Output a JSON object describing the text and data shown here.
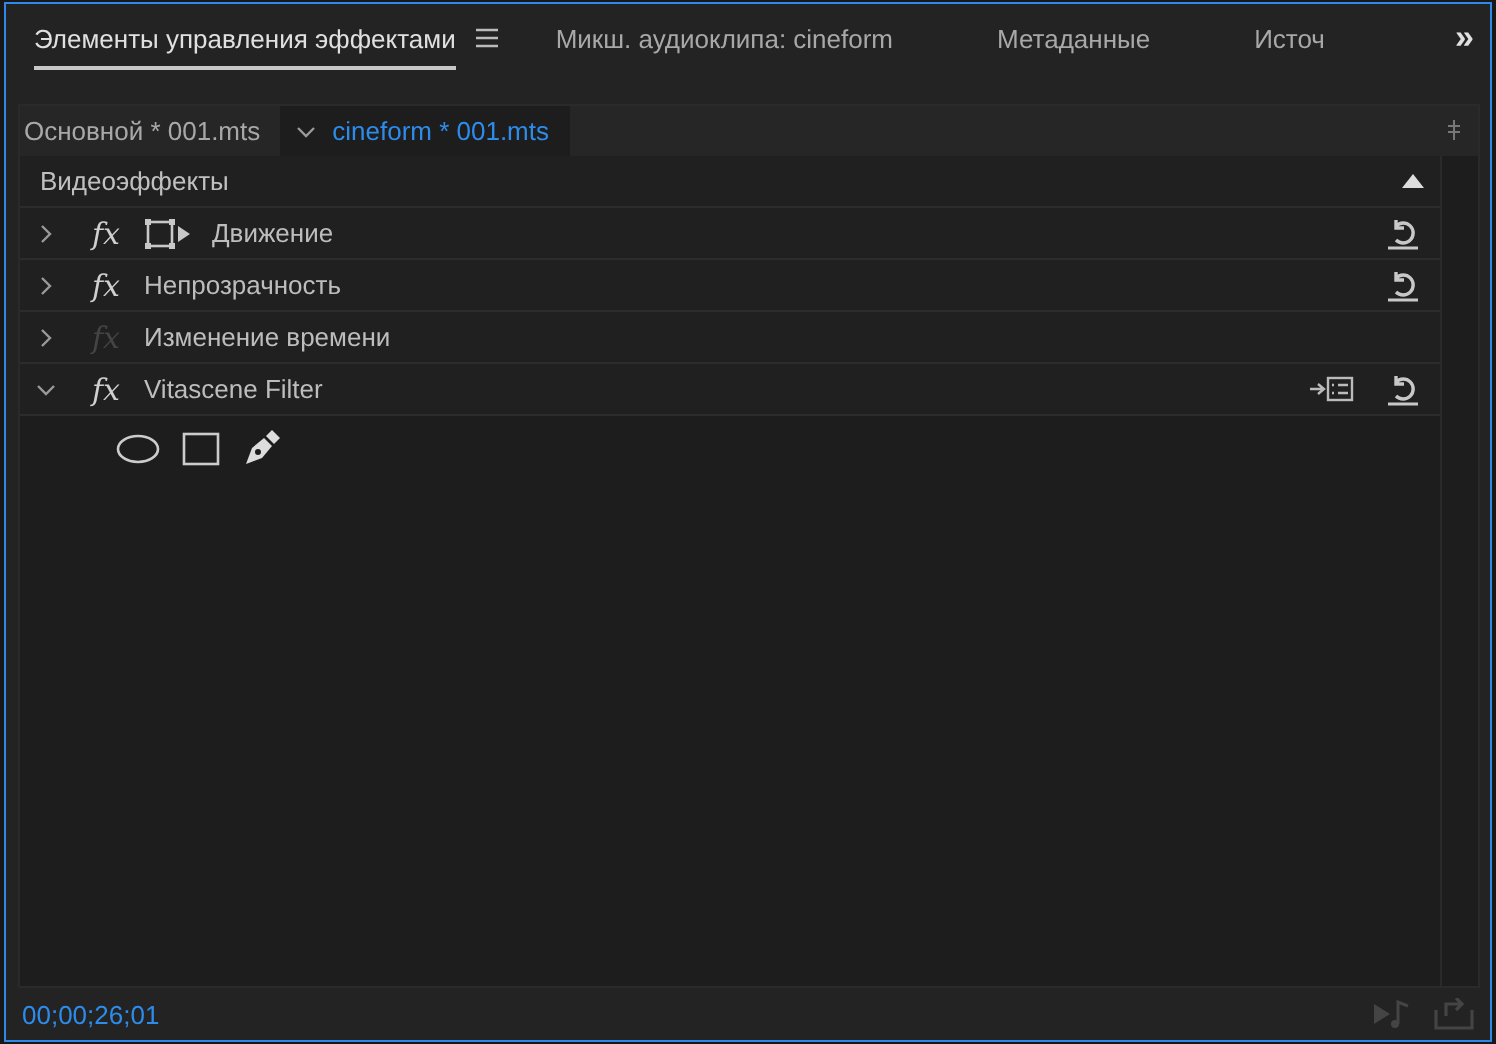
{
  "panel_tabs": [
    {
      "label": "Элементы управления эффектами",
      "selected": true,
      "menu": true
    },
    {
      "label": "Микш. аудиоклипа: cineform",
      "selected": false,
      "menu": false
    },
    {
      "label": "Метаданные",
      "selected": false,
      "menu": false
    },
    {
      "label": "Источ",
      "selected": false,
      "menu": false
    }
  ],
  "overflow_button": "»",
  "clip_tabs": [
    {
      "label": "Основной * 001.mts",
      "selected": false
    },
    {
      "label": "cineform * 001.mts",
      "selected": true
    }
  ],
  "section": {
    "title": "Видеоэффекты",
    "expanded": true
  },
  "effects": [
    {
      "fx": "fx",
      "name": "Движение",
      "expanded": false,
      "fx_enabled": true,
      "transform_icon": true,
      "reset_button": true,
      "preset_button": false
    },
    {
      "fx": "fx",
      "name": "Непрозрачность",
      "expanded": false,
      "fx_enabled": true,
      "transform_icon": false,
      "reset_button": true,
      "preset_button": false
    },
    {
      "fx": "fx",
      "name": "Изменение времени",
      "expanded": false,
      "fx_enabled": false,
      "transform_icon": false,
      "reset_button": false,
      "preset_button": false
    },
    {
      "fx": "fx",
      "name": "Vitascene Filter",
      "expanded": true,
      "fx_enabled": true,
      "transform_icon": false,
      "reset_button": true,
      "preset_button": true
    }
  ],
  "footer": {
    "timecode": "00;00;26;01"
  }
}
